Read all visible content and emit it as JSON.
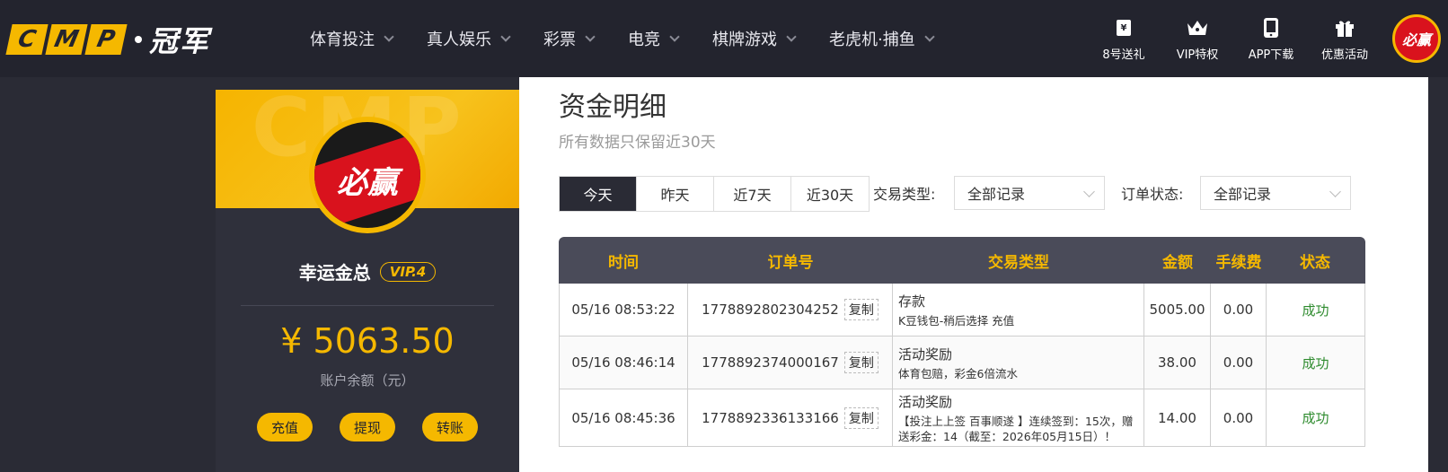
{
  "logo": {
    "letters": [
      "C",
      "M",
      "P"
    ],
    "cn": "冠军"
  },
  "nav": {
    "items": [
      "体育投注",
      "真人娱乐",
      "彩票",
      "电竞",
      "棋牌游戏",
      "老虎机·捕鱼"
    ]
  },
  "right_nav": {
    "items": [
      {
        "label": "8号送礼",
        "icon": "gift-card-icon"
      },
      {
        "label": "VIP特权",
        "icon": "crown-icon"
      },
      {
        "label": "APP下载",
        "icon": "phone-icon"
      },
      {
        "label": "优惠活动",
        "icon": "gift-icon"
      }
    ],
    "avatar_text": "必赢"
  },
  "profile": {
    "avatar_text": "必赢",
    "username": "幸运金总",
    "vip": "VIP.4",
    "balance": "¥ 5063.50",
    "balance_label": "账户余额（元）",
    "actions": [
      "充值",
      "提现",
      "转账"
    ]
  },
  "page": {
    "title": "资金明细",
    "subtitle": "所有数据只保留近30天"
  },
  "filters": {
    "date_tabs": [
      "今天",
      "昨天",
      "近7天",
      "近30天"
    ],
    "active_tab": "今天",
    "type_label": "交易类型:",
    "type_value": "全部记录",
    "status_label": "订单状态:",
    "status_value": "全部记录"
  },
  "table": {
    "headers": [
      "时间",
      "订单号",
      "交易类型",
      "金额",
      "手续费",
      "状态"
    ],
    "copy_label": "复制",
    "rows": [
      {
        "time": "05/16 08:53:22",
        "order": "1778892802304252",
        "type": "存款",
        "type_detail": "K豆钱包-稍后选择 充值",
        "amount": "5005.00",
        "fee": "0.00",
        "status": "成功"
      },
      {
        "time": "05/16 08:46:14",
        "order": "1778892374000167",
        "type": "活动奖励",
        "type_detail": "体育包赔，彩金6倍流水",
        "amount": "38.00",
        "fee": "0.00",
        "status": "成功"
      },
      {
        "time": "05/16 08:45:36",
        "order": "1778892336133166",
        "type": "活动奖励",
        "type_detail": "【投注上上签 百事顺遂 】连续签到：15次，赠送彩金：14（截至：2026年05月15日）！",
        "amount": "14.00",
        "fee": "0.00",
        "status": "成功"
      }
    ]
  },
  "colors": {
    "accent": "#f5b800",
    "dark": "#23242e",
    "success": "#2e8b2e"
  }
}
